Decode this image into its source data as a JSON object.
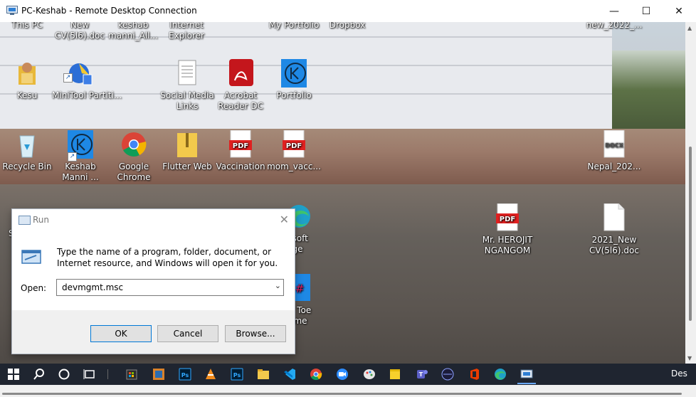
{
  "window": {
    "title": "PC-Keshab - Remote Desktop Connection",
    "minimize": "—",
    "maximize": "☐",
    "close": "✕"
  },
  "desktop": {
    "top_row_labels": [
      "This PC",
      "New\nCV(5l6).doc",
      "keshab\nmanni_All...",
      "Internet\nExplorer",
      "My Portfolio",
      "Dropbox",
      "new_2022_..."
    ],
    "icons": [
      {
        "label": "Kesu",
        "icon": "folder-user-icon"
      },
      {
        "label": "MiniTool Partiti...",
        "icon": "minitool-icon"
      },
      {
        "label": "Social Media Links",
        "icon": "text-file-icon"
      },
      {
        "label": "Acrobat Reader DC",
        "icon": "acrobat-icon"
      },
      {
        "label": "Portfolio",
        "icon": "kodi-icon"
      },
      {
        "label": "Recycle Bin",
        "icon": "recycle-bin-icon"
      },
      {
        "label": "Keshab Manni ...",
        "icon": "kodi-icon"
      },
      {
        "label": "Google Chrome",
        "icon": "chrome-icon"
      },
      {
        "label": "Flutter Web",
        "icon": "zip-folder-icon"
      },
      {
        "label": "Vaccination",
        "icon": "pdf-icon"
      },
      {
        "label": "mom_vacc...",
        "icon": "pdf-icon"
      },
      {
        "label": "Nepal_202...",
        "icon": "docx-icon"
      },
      {
        "label": "Mr. HEROJIT NGANGOM",
        "icon": "pdf-icon"
      },
      {
        "label": "2021_New CV(5l6).doc",
        "icon": "doc-icon"
      },
      {
        "label": "SA",
        "icon": "partial-icon"
      },
      {
        "label": "osoft ge",
        "icon": "edge-icon"
      },
      {
        "label": "c Toe me",
        "icon": "tic-tac-toe-icon"
      }
    ]
  },
  "run_dialog": {
    "title": "Run",
    "close": "✕",
    "description": "Type the name of a program, folder, document, or Internet resource, and Windows will open it for you.",
    "open_label": "Open:",
    "input_value": "devmgmt.msc",
    "ok": "OK",
    "cancel": "Cancel",
    "browse": "Browse..."
  },
  "taskbar": {
    "items": [
      "start-icon",
      "search-icon",
      "cortana-icon",
      "task-view-icon",
      "store-icon",
      "folder-icon",
      "photoshop-icon",
      "vlc-icon",
      "photoshop-icon",
      "file-explorer-icon",
      "vscode-icon",
      "chrome-icon",
      "zoom-icon",
      "paint-icon",
      "sticky-notes-icon",
      "teams-icon",
      "app-icon",
      "office-icon",
      "edge-icon",
      "remote-desktop-icon"
    ],
    "overflow_text": "Des"
  }
}
